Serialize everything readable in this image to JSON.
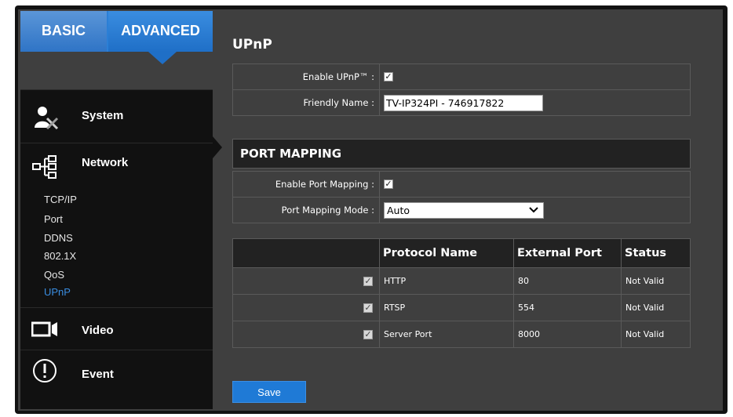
{
  "sidebar": {
    "tabs": {
      "basic": "BASIC",
      "advanced": "ADVANCED"
    },
    "groups": {
      "system": {
        "label": "System",
        "icon": "admin-tools-icon"
      },
      "network": {
        "label": "Network",
        "icon": "network-tree-icon"
      },
      "video": {
        "label": "Video",
        "icon": "video-camera-icon"
      },
      "event": {
        "label": "Event",
        "icon": "exclamation-circle-icon"
      }
    },
    "network_items": [
      "TCP/IP",
      "Port",
      "DDNS",
      "802.1X",
      "QoS",
      "UPnP"
    ],
    "active_item": "UPnP"
  },
  "page": {
    "title": "UPnP",
    "enable_upnp": {
      "label": "Enable UPnP™ :",
      "checked": true
    },
    "friendly_name": {
      "label": "Friendly Name :",
      "value": "TV-IP324PI - 746917822"
    }
  },
  "port_mapping": {
    "heading": "PORT MAPPING",
    "enable": {
      "label": "Enable Port Mapping :",
      "checked": true
    },
    "mode": {
      "label": "Port Mapping Mode :",
      "value": "Auto"
    },
    "columns": [
      "Protocol Name",
      "External Port",
      "Status"
    ],
    "rows": [
      {
        "enabled": true,
        "protocol": "HTTP",
        "external_port": "80",
        "status": "Not Valid"
      },
      {
        "enabled": true,
        "protocol": "RTSP",
        "external_port": "554",
        "status": "Not Valid"
      },
      {
        "enabled": true,
        "protocol": "Server Port",
        "external_port": "8000",
        "status": "Not Valid"
      }
    ]
  },
  "buttons": {
    "save": "Save"
  },
  "colors": {
    "accent": "#1f7ad6",
    "active_item": "#3a8de0",
    "panel_bg": "#3f3f3f",
    "sidebar_bg": "#111111"
  }
}
